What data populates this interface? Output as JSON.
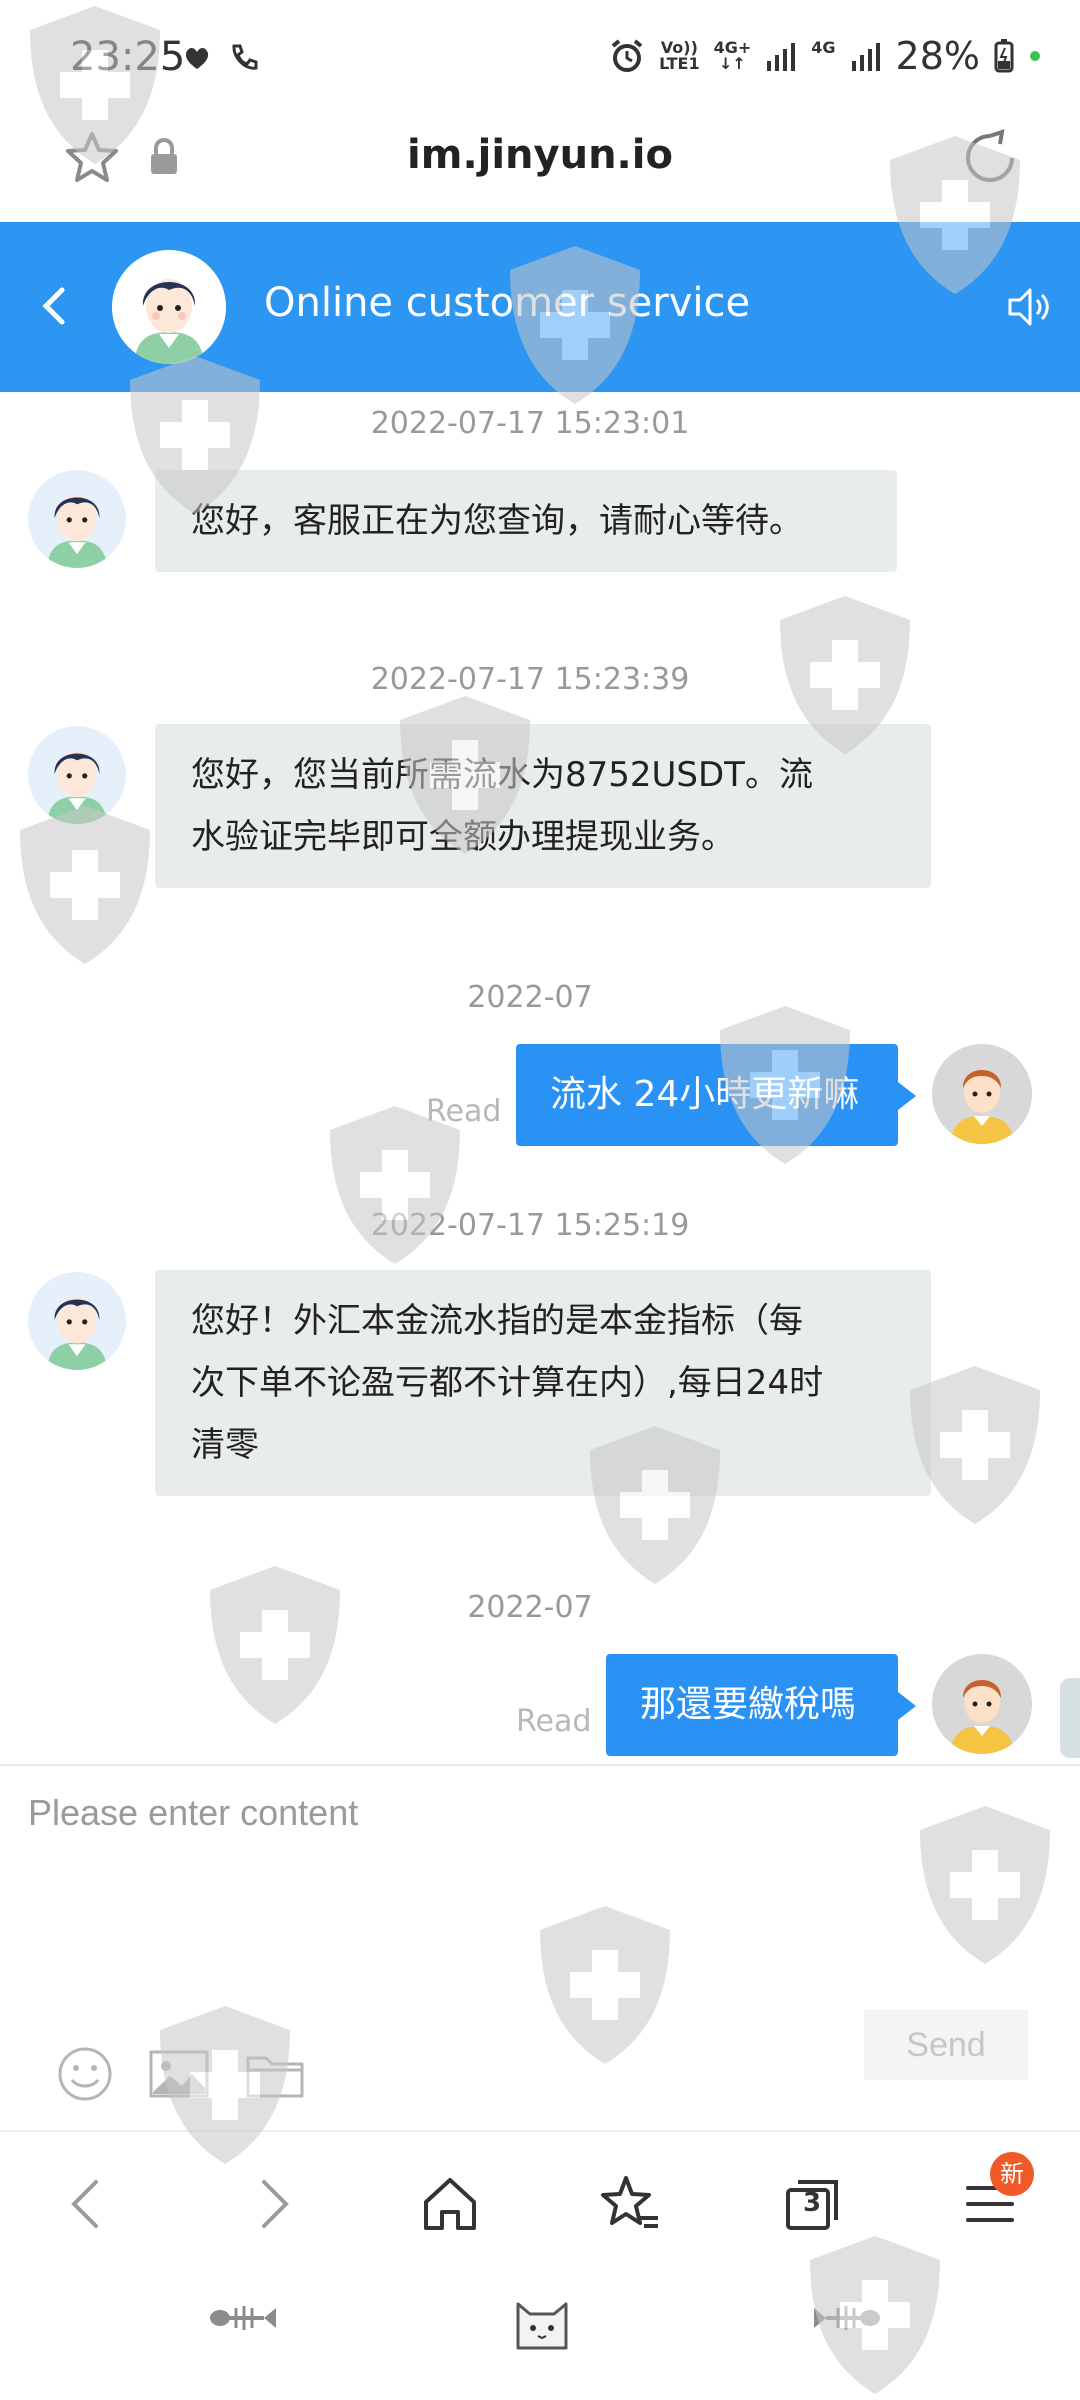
{
  "status_bar": {
    "time": "23:25",
    "volte_label": "Vo))",
    "lte_label": "LTE1",
    "net1_label": "4G+",
    "net2_label": "4G",
    "battery": "28%"
  },
  "address_bar": {
    "url": "im.jinyun.io"
  },
  "chat_header": {
    "title": "Online customer service"
  },
  "messages": [
    {
      "timestamp": "2022-07-17 15:23:01",
      "text": "您好，客服正在为您查询，请耐心等待。"
    },
    {
      "timestamp": "2022-07-17 15:23:39",
      "lines": [
        "您好，您当前所需流水为8752USDT。流",
        "水验证完毕即可全额办理提现业务。"
      ]
    },
    {
      "timestamp": "2022-07",
      "text": "流水 24小時更新嘛",
      "status": "Read"
    },
    {
      "timestamp": "2022-07-17 15:25:19",
      "lines": [
        "您好！外汇本金流水指的是本金指标（每",
        "次下单不论盈亏都不计算在内）,每日24时",
        "清零"
      ]
    },
    {
      "timestamp": "2022-07",
      "text": "那還要繳稅嗎",
      "status": "Read"
    }
  ],
  "input": {
    "placeholder": "Please enter content",
    "value": "",
    "send_label": "Send"
  },
  "browser_nav": {
    "tabs_count": "3",
    "menu_badge": "新"
  },
  "colors": {
    "header_blue": "#2c96f2",
    "outgoing_bubble": "#2a92f5",
    "incoming_bubble": "#e9eced",
    "badge": "#f05a28"
  },
  "icons": [
    "star-icon",
    "lock-icon",
    "reload-icon",
    "back-icon",
    "speaker-icon",
    "emoji-icon",
    "image-icon",
    "folder-icon",
    "arrow-left-icon",
    "arrow-right-icon",
    "home-icon",
    "bookmarks-icon",
    "tabs-icon",
    "menu-icon",
    "fishbone-icon",
    "cat-icon"
  ]
}
